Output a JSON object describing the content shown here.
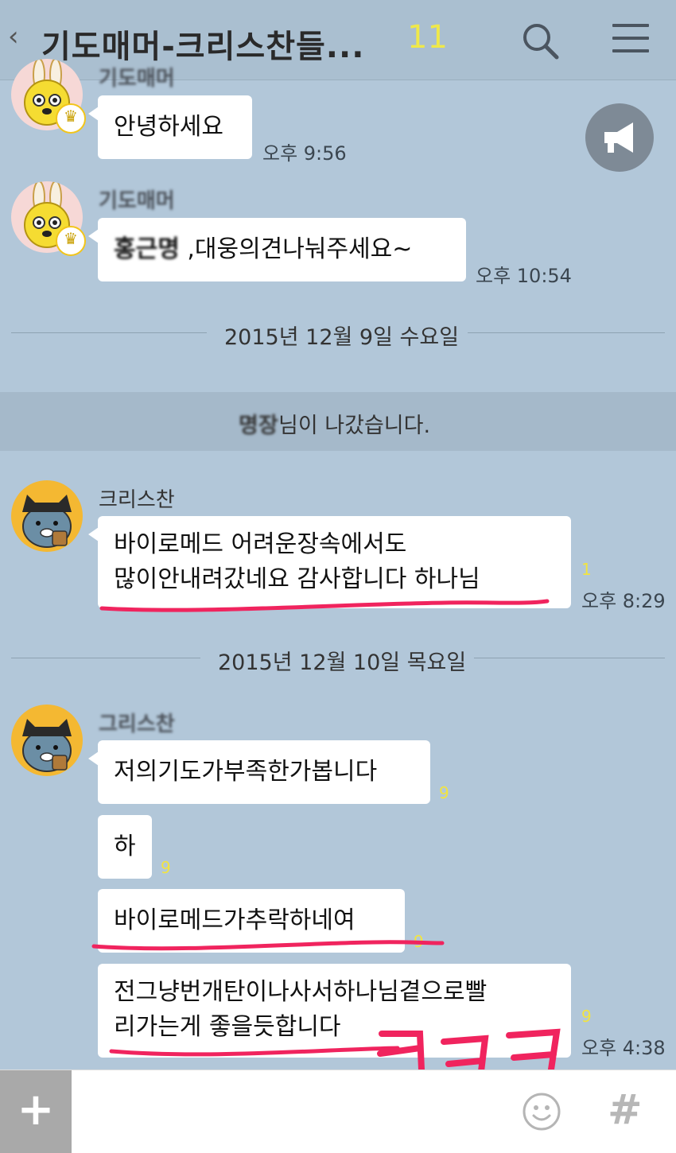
{
  "header": {
    "back_icon": "chevron-left-icon",
    "title": "기도매머-크리스찬들...",
    "member_count": "11",
    "search_icon": "search-icon",
    "menu_icon": "menu-icon"
  },
  "messages": [
    {
      "sender": "기도매머",
      "avatar": "bunny-avatar",
      "text": "안녕하세요",
      "time": "오후 9:56"
    },
    {
      "sender": "기도매머",
      "avatar": "bunny-avatar",
      "text_blurred": "홍근명",
      "text": " ,대웅의견나눠주세요~",
      "time": "오후 10:54"
    }
  ],
  "date_divider_1": "2015년 12월 9일 수요일",
  "system_notice": {
    "name_blurred": "명장",
    "text": "님이 나갔습니다."
  },
  "messages2": [
    {
      "sender": "크리스찬",
      "line1": "바이로메드 어려운장속에서도",
      "line2": "많이안내려갔네요 감사합니다 하나님",
      "unread": "1",
      "time": "오후 8:29"
    }
  ],
  "date_divider_2": "2015년 12월 10일 목요일",
  "messages3": {
    "sender": "그리스찬",
    "items": [
      {
        "text": "저의기도가부족한가봅니다",
        "unread": "9"
      },
      {
        "text": "하",
        "unread": "9"
      },
      {
        "text": "바이로메드가추락하네여",
        "unread": "9"
      },
      {
        "line1": "전그냥번개탄이나사서하나님곁으로빨",
        "line2": "리가는게 좋을듯합니다",
        "unread": "9",
        "time": "오후 4:38"
      }
    ]
  },
  "input_bar": {
    "plus_label": "+",
    "emoji_icon": "smiley-icon",
    "hash_label": "#"
  },
  "megaphone_icon": "megaphone-icon",
  "colors": {
    "background": "#b2c7d9",
    "bubble": "#ffffff",
    "annotation": "#f0245e",
    "unread": "#f2e440"
  }
}
